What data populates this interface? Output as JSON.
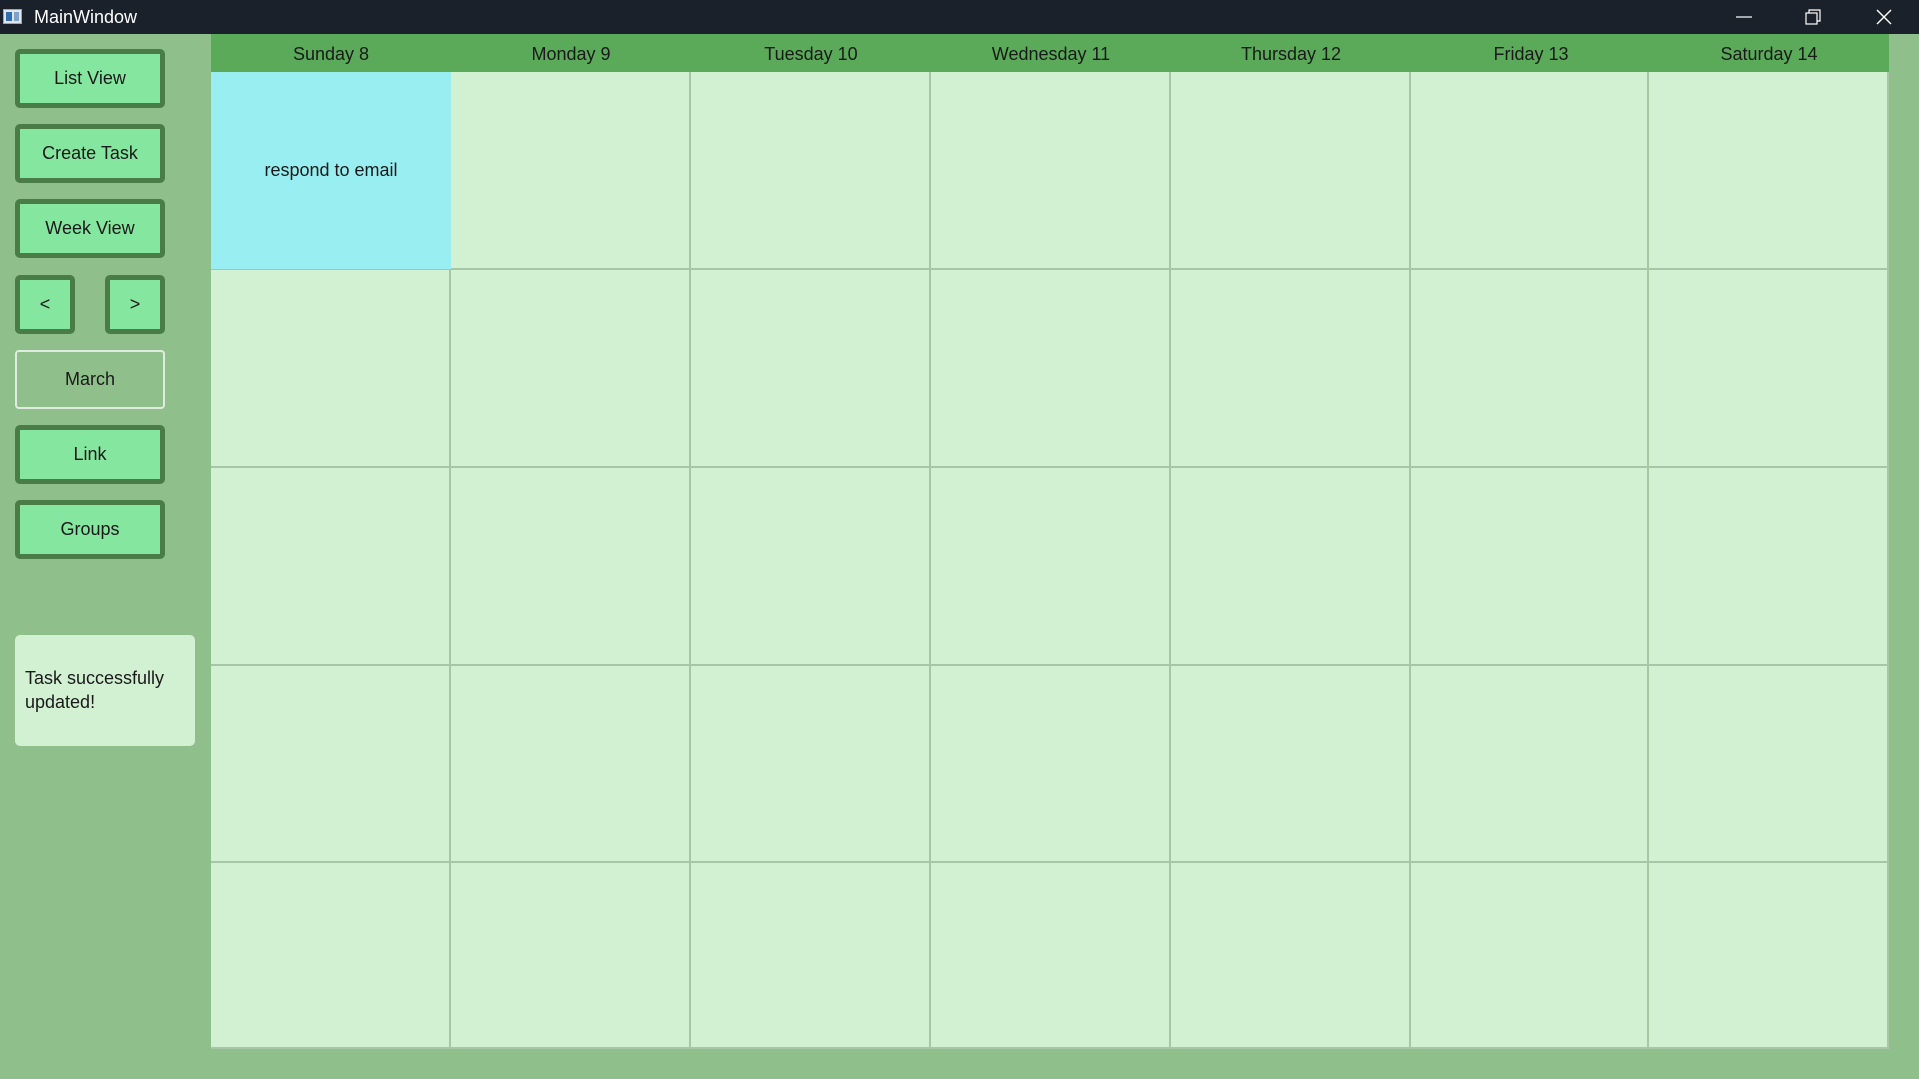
{
  "window": {
    "title": "MainWindow"
  },
  "sidebar": {
    "list_view": "List View",
    "create_task": "Create Task",
    "week_view": "Week View",
    "prev": "<",
    "next": ">",
    "month": "March",
    "link": "Link",
    "groups": "Groups",
    "status": "Task successfully updated!"
  },
  "calendar": {
    "days": [
      "Sunday 8",
      "Monday 9",
      "Tuesday 10",
      "Wednesday 11",
      "Thursday 12",
      "Friday 13",
      "Saturday 14"
    ],
    "tasks": [
      {
        "day": "Sunday 8",
        "title": "respond to email"
      }
    ]
  },
  "colors": {
    "background": "#8fbf8a",
    "button": "#85e69f",
    "button_border": "#4a7c48",
    "header": "#5aaa5a",
    "cell": "#d2f0d2",
    "task": "#98eef0",
    "titlebar": "#1b212b"
  },
  "icons": [
    "app-icon",
    "minimize-icon",
    "maximize-icon",
    "close-icon"
  ]
}
